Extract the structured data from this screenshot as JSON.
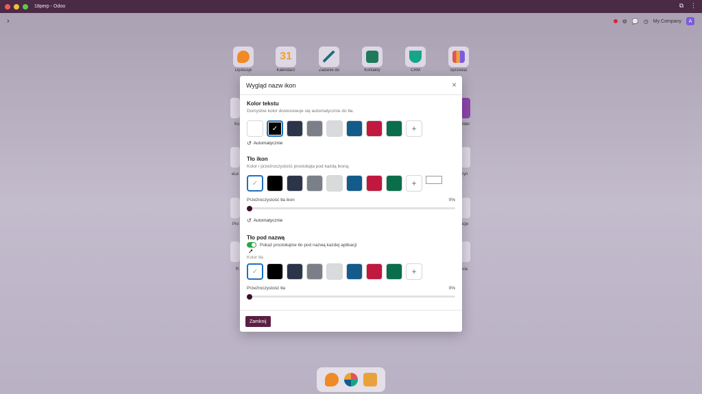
{
  "window": {
    "title": "18perp - Odoo"
  },
  "systray": {
    "company": "My Company",
    "avatar_letter": "A"
  },
  "apps": [
    {
      "label": "Dyskusje",
      "color": "#f08a24"
    },
    {
      "label": "Kalendarz",
      "color": "#e9a23b",
      "text": "31"
    },
    {
      "label": "Zadanie do",
      "color": "#1f6e7a"
    },
    {
      "label": "Kontakty",
      "color": "#1e7a5a"
    },
    {
      "label": "CRM",
      "color": "#17a589"
    },
    {
      "label": "Sprzedaż",
      "color": "#e05555"
    }
  ],
  "side_labels": {
    "l1": "Ko",
    "l2": "eLe",
    "l3": "Pro",
    "l4": "R",
    "r1": "ilder",
    "r2": "ryn",
    "r3": "acje",
    "r4": "eria"
  },
  "modal": {
    "title": "Wygląd nazw ikon",
    "close_icon": "×",
    "text_color": {
      "title": "Kolor tekstu",
      "description": "Domyślne kolor dostosowuje się automatycznie do tła.",
      "swatches": [
        "#ffffff",
        "#000000",
        "#2b3448",
        "#7a7f88",
        "#d9dadc",
        "#135b8a",
        "#c0183f",
        "#0a6e4a"
      ],
      "selected_index": 1,
      "auto_label": "Automatycznie"
    },
    "icon_bg": {
      "title": "Tło ikon",
      "description": "Kolor i przeźroczystość prostokąta pod każdą ikoną.",
      "swatches": [
        "#ffffff",
        "#000000",
        "#2b3448",
        "#7a7f88",
        "#d9dadc",
        "#135b8a",
        "#c0183f",
        "#0a6e4a"
      ],
      "selected_index": 0,
      "opacity_label": "Przeźroczystość tła ikon",
      "opacity_value": "0%",
      "opacity_fraction": 0,
      "auto_label": "Automatycznie"
    },
    "name_bg": {
      "title": "Tło pod nazwą",
      "toggle_label": "Pokaż prostokątne tło pod nazwą każdej aplikacji",
      "toggle_on": true,
      "color_label": "Kolor tła",
      "swatches": [
        "#ffffff",
        "#000000",
        "#2b3448",
        "#7a7f88",
        "#d9dadc",
        "#135b8a",
        "#c0183f",
        "#0a6e4a"
      ],
      "selected_index": 0,
      "opacity_label": "Przeźroczystość tła",
      "opacity_value": "0%",
      "opacity_fraction": 0
    },
    "close_button": "Zamknij"
  }
}
